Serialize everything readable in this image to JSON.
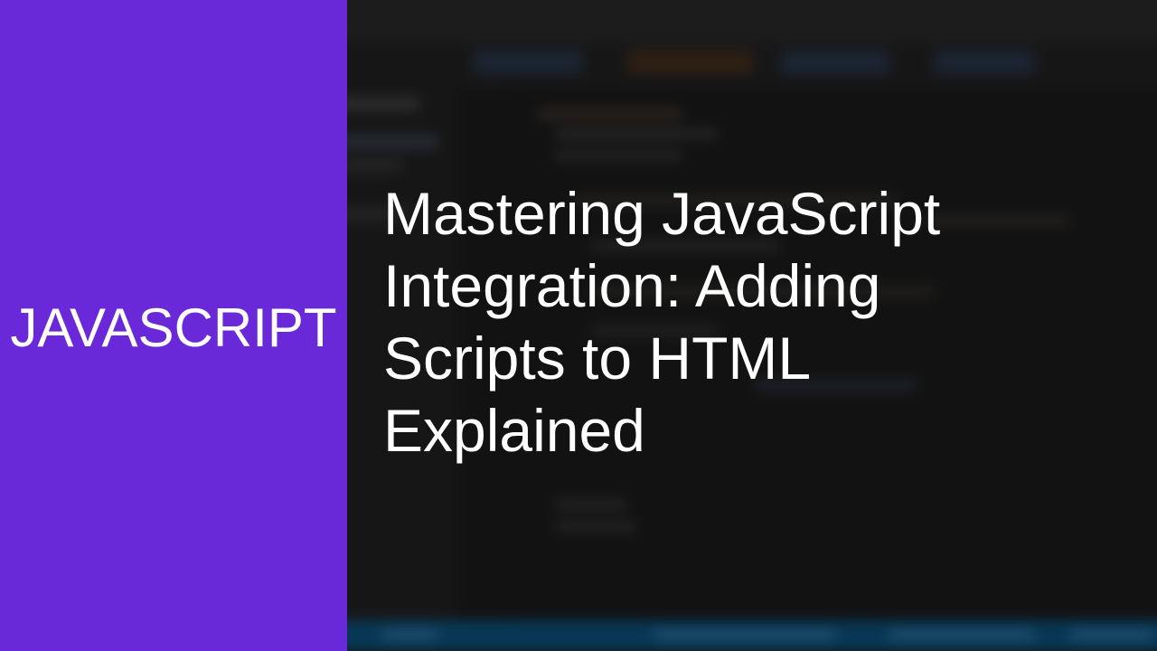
{
  "category": {
    "label": "JAVASCRIPT",
    "color": "#6a29d9"
  },
  "article": {
    "title": "Mastering JavaScript Integration: Adding Scripts to HTML Explained"
  },
  "background": {
    "description_icon": "blurred-code-editor-backdrop"
  }
}
